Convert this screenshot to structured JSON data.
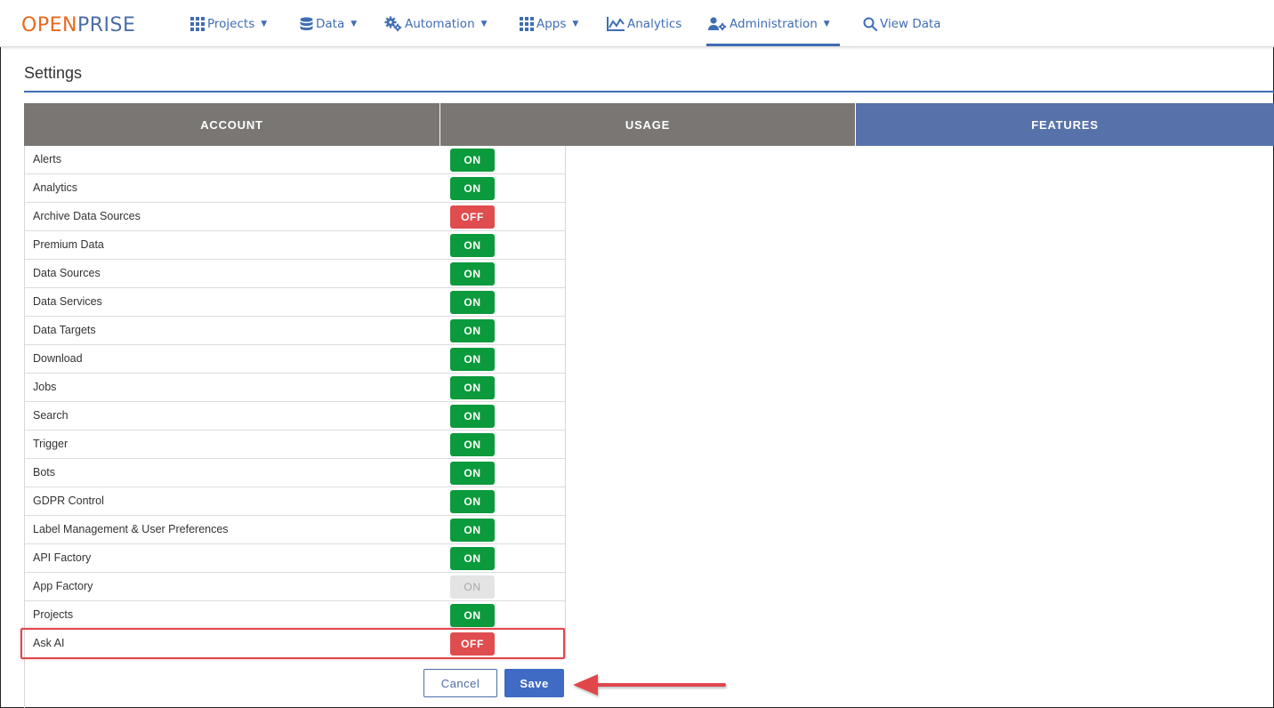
{
  "brand": {
    "part1": "OPEN",
    "part2": "PRISE"
  },
  "nav": {
    "projects": "Projects",
    "data": "Data",
    "automation": "Automation",
    "apps": "Apps",
    "analytics": "Analytics",
    "administration": "Administration",
    "view_data": "View Data",
    "active": "Administration"
  },
  "page": {
    "title": "Settings"
  },
  "tabs": {
    "account": "ACCOUNT",
    "usage": "USAGE",
    "features": "FEATURES",
    "active": "FEATURES"
  },
  "features": [
    {
      "label": "Alerts",
      "state": "ON",
      "status": "on"
    },
    {
      "label": "Analytics",
      "state": "ON",
      "status": "on"
    },
    {
      "label": "Archive Data Sources",
      "state": "OFF",
      "status": "off"
    },
    {
      "label": "Premium Data",
      "state": "ON",
      "status": "on"
    },
    {
      "label": "Data Sources",
      "state": "ON",
      "status": "on"
    },
    {
      "label": "Data Services",
      "state": "ON",
      "status": "on"
    },
    {
      "label": "Data Targets",
      "state": "ON",
      "status": "on"
    },
    {
      "label": "Download",
      "state": "ON",
      "status": "on"
    },
    {
      "label": "Jobs",
      "state": "ON",
      "status": "on"
    },
    {
      "label": "Search",
      "state": "ON",
      "status": "on"
    },
    {
      "label": "Trigger",
      "state": "ON",
      "status": "on"
    },
    {
      "label": "Bots",
      "state": "ON",
      "status": "on"
    },
    {
      "label": "GDPR Control",
      "state": "ON",
      "status": "on"
    },
    {
      "label": "Label Management & User Preferences",
      "state": "ON",
      "status": "on"
    },
    {
      "label": "API Factory",
      "state": "ON",
      "status": "on"
    },
    {
      "label": "App Factory",
      "state": "ON",
      "status": "disabled"
    },
    {
      "label": "Projects",
      "state": "ON",
      "status": "on"
    },
    {
      "label": "Ask AI",
      "state": "OFF",
      "status": "off"
    }
  ],
  "actions": {
    "cancel": "Cancel",
    "save": "Save"
  },
  "colors": {
    "accent": "#3f6db3",
    "brand_orange": "#e8691e",
    "toggle_on": "#0b9a3c",
    "toggle_off": "#df4d4f",
    "highlight": "#e0474b"
  },
  "icons": {
    "projects": "grid-icon",
    "data": "database-icon",
    "automation": "gears-icon",
    "apps": "grid-icon",
    "analytics": "chart-icon",
    "administration": "user-gear-icon",
    "view_data": "search-icon"
  }
}
